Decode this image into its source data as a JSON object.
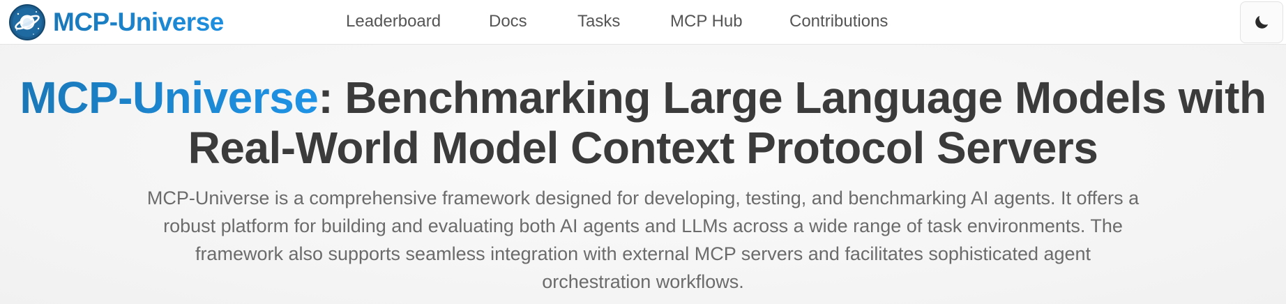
{
  "brand": {
    "name": "MCP-Universe",
    "logo_icon": "planet-icon",
    "accent_color": "#1a86cf"
  },
  "nav": {
    "items": [
      {
        "label": "Leaderboard"
      },
      {
        "label": "Docs"
      },
      {
        "label": "Tasks"
      },
      {
        "label": "MCP Hub"
      },
      {
        "label": "Contributions"
      }
    ],
    "theme_toggle_icon": "moon-icon"
  },
  "hero": {
    "title_accent": "MCP-Universe",
    "title_rest": ": Benchmarking Large Language Models with Real-World Model Context Protocol Servers",
    "description": "MCP-Universe is a comprehensive framework designed for developing, testing, and benchmarking AI agents. It offers a robust platform for building and evaluating both AI agents and LLMs across a wide range of task environments. The framework also supports seamless integration with external MCP servers and facilitates sophisticated agent orchestration workflows.",
    "text_color": "#3b3b3b",
    "description_color": "#6b6b6b"
  }
}
